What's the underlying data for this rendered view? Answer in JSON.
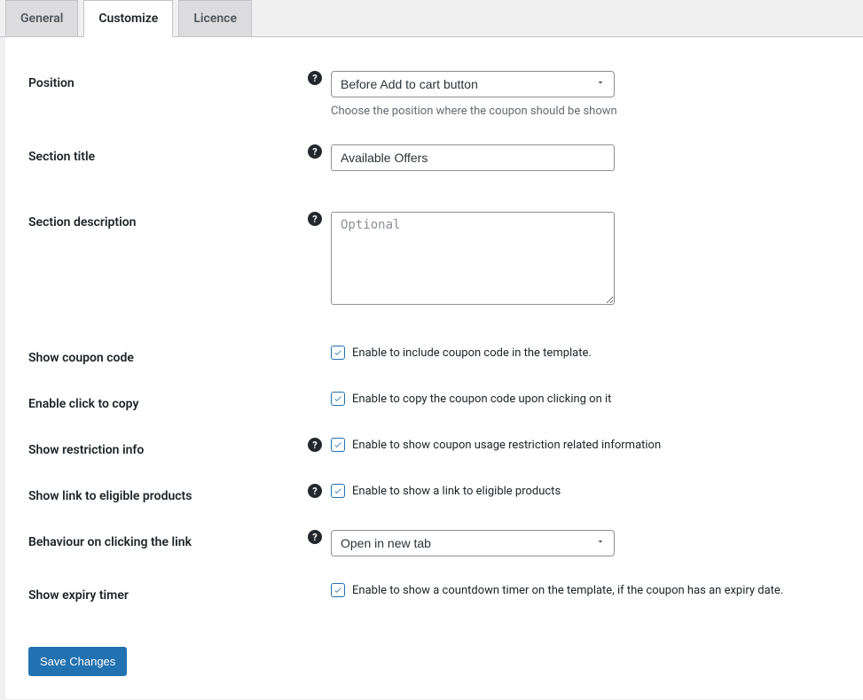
{
  "tabs": {
    "general": "General",
    "customize": "Customize",
    "licence": "Licence"
  },
  "fields": {
    "position": {
      "label": "Position",
      "selected": "Before Add to cart button",
      "description": "Choose the position where the coupon should be shown"
    },
    "section_title": {
      "label": "Section title",
      "value": "Available Offers"
    },
    "section_description": {
      "label": "Section description",
      "placeholder": "Optional",
      "value": ""
    },
    "show_coupon_code": {
      "label": "Show coupon code",
      "checkbox_label": "Enable to include coupon code in the template."
    },
    "click_to_copy": {
      "label": "Enable click to copy",
      "checkbox_label": "Enable to copy the coupon code upon clicking on it"
    },
    "restriction_info": {
      "label": "Show restriction info",
      "checkbox_label": "Enable to show coupon usage restriction related information"
    },
    "eligible_link": {
      "label": "Show link to eligible products",
      "checkbox_label": "Enable to show a link to eligible products"
    },
    "link_behaviour": {
      "label": "Behaviour on clicking the link",
      "selected": "Open in new tab"
    },
    "expiry_timer": {
      "label": "Show expiry timer",
      "checkbox_label": "Enable to show a countdown timer on the template, if the coupon has an expiry date."
    }
  },
  "buttons": {
    "save": "Save Changes"
  }
}
